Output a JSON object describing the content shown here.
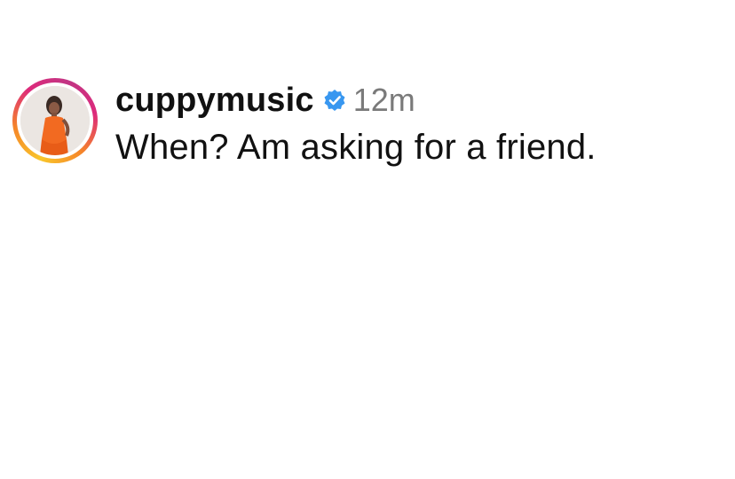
{
  "comment": {
    "username": "cuppymusic",
    "verified_icon": "verified-badge-icon",
    "timestamp": "12m",
    "text": "When? Am asking for a friend."
  },
  "colors": {
    "verified_blue": "#3897f0",
    "text": "#111111",
    "timestamp": "#7a7a7a",
    "story_ring": [
      "#f9c62b",
      "#f58529",
      "#dd2a7b",
      "#c13584"
    ]
  }
}
